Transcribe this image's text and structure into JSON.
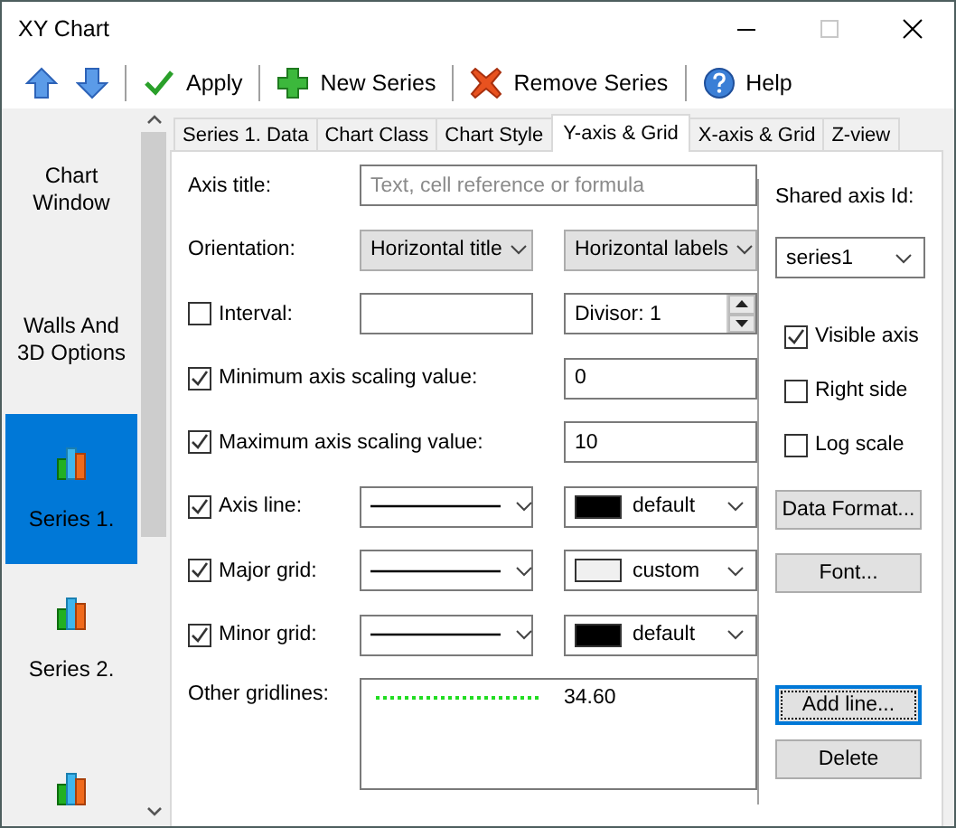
{
  "window": {
    "title": "XY Chart"
  },
  "toolbar": [
    {
      "kind": "up",
      "separator": false
    },
    {
      "kind": "down",
      "separator": false
    },
    {
      "kind": "apply",
      "label": "Apply",
      "separator": true
    },
    {
      "kind": "add",
      "label": "New Series",
      "separator": true
    },
    {
      "kind": "remove",
      "label": "Remove Series",
      "separator": true
    },
    {
      "kind": "help",
      "label": "Help",
      "separator": true
    }
  ],
  "sidebar": {
    "items": [
      {
        "kind": "text",
        "label": "Chart Window",
        "selected": false
      },
      {
        "kind": "text",
        "label": "Walls And 3D Options",
        "selected": false
      },
      {
        "kind": "series",
        "label": "Series 1.",
        "selected": true
      },
      {
        "kind": "series",
        "label": "Series 2.",
        "selected": false
      },
      {
        "kind": "series",
        "selected": false
      }
    ]
  },
  "tabs": [
    {
      "label": "Series 1. Data",
      "selected": false
    },
    {
      "label": "Chart Class",
      "selected": false
    },
    {
      "label": "Chart Style",
      "selected": false
    },
    {
      "label": "Y-axis & Grid",
      "selected": true
    },
    {
      "label": "X-axis & Grid",
      "selected": false
    },
    {
      "label": "Z-view",
      "selected": false
    }
  ],
  "form": {
    "axis_title": {
      "label": "Axis title:",
      "placeholder": "Text, cell reference or formula"
    },
    "orientation": {
      "label": "Orientation:",
      "title_value": "Horizontal title",
      "labels_value": "Horizontal labels"
    },
    "interval": {
      "label": "Interval:",
      "checked": false,
      "divisor": "Divisor: 1"
    },
    "minimum": {
      "label": "Minimum axis scaling value:",
      "checked": true,
      "value": "0"
    },
    "maximum": {
      "label": "Maximum axis scaling value:",
      "checked": true,
      "value": "10"
    },
    "lines": [
      {
        "label": "Axis line:",
        "checked": true,
        "color": "#000000",
        "color_name": "default"
      },
      {
        "label": "Major grid:",
        "checked": true,
        "color": "#f0f0f0",
        "color_name": "custom"
      },
      {
        "label": "Minor grid:",
        "checked": true,
        "color": "#000000",
        "color_name": "default"
      }
    ],
    "other_gridlines": {
      "label": "Other gridlines:",
      "items": [
        {
          "color": "#22dd22",
          "value": "34.60"
        }
      ]
    }
  },
  "side": {
    "shared_axis_label": "Shared axis Id:",
    "shared_axis_value": "series1",
    "options": [
      {
        "label": "Visible axis",
        "checked": true
      },
      {
        "label": "Right side",
        "checked": false
      },
      {
        "label": "Log scale",
        "checked": false
      }
    ],
    "buttons": [
      {
        "label": "Data Format...",
        "focused": false
      },
      {
        "label": "Font...",
        "focused": false
      }
    ],
    "gridline_buttons": [
      {
        "label": "Add line...",
        "focused": true
      },
      {
        "label": "Delete",
        "focused": false
      }
    ]
  }
}
